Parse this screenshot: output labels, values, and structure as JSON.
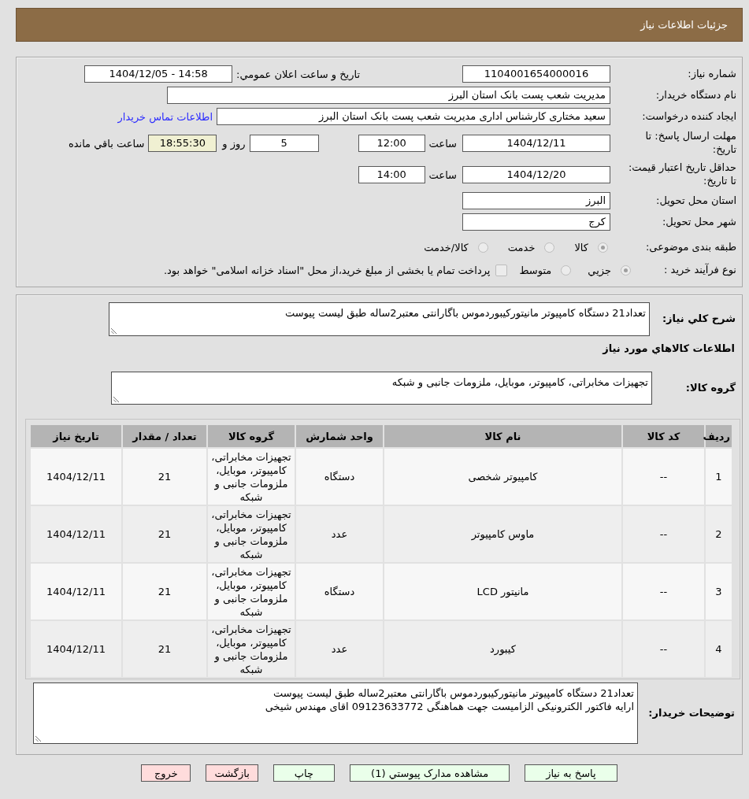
{
  "header": {
    "title": "جزئیات اطلاعات نیاز"
  },
  "details": {
    "need_number": {
      "label": "شماره نیاز:",
      "value": "1104001654000016"
    },
    "announcement": {
      "label": "تاریخ و ساعت اعلان عمومي:",
      "value": "1404/12/05 - 14:58"
    },
    "buyer_org": {
      "label": "نام دستگاه خریدار:",
      "value": "مدیریت شعب پست بانک استان البرز"
    },
    "requester": {
      "label": "ایجاد کننده درخواست:",
      "value": "سعید مختاری کارشناس اداری مدیریت شعب پست بانک استان البرز",
      "link": "اطلاعات تماس خریدار"
    },
    "response_deadline": {
      "label": "مهلت ارسال پاسخ: تا تاریخ:",
      "date": "1404/12/11",
      "time_label": "ساعت",
      "time": "12:00",
      "days": "5",
      "days_label": "روز و",
      "remaining": "18:55:30",
      "remaining_label": "ساعت باقي مانده"
    },
    "price_validity": {
      "label": "حداقل تاریخ اعتبار قیمت: تا تاریخ:",
      "date": "1404/12/20",
      "time_label": "ساعت",
      "time": "14:00"
    },
    "province": {
      "label": "استان محل تحویل:",
      "value": "البرز"
    },
    "city": {
      "label": "شهر محل تحویل:",
      "value": "کرج"
    },
    "category": {
      "label": "طبقه بندی موضوعی:",
      "disabled": true,
      "options": [
        {
          "label": "کالا",
          "selected": true
        },
        {
          "label": "خدمت",
          "selected": false
        },
        {
          "label": "کالا/خدمت",
          "selected": false
        }
      ]
    },
    "process": {
      "label": "نوع فرآیند خرید :",
      "disabled": true,
      "options": [
        {
          "label": "جزيي",
          "selected": true
        },
        {
          "label": "متوسط",
          "selected": false
        }
      ],
      "treasury": {
        "label": "پرداخت تمام یا بخشی از مبلغ خرید،از محل \"اسناد خزانه اسلامی\" خواهد بود.",
        "checked": false
      }
    }
  },
  "need": {
    "summary": {
      "label": "شرح کلي نیاز:",
      "value": "تعداد21 دستگاه کامپیوتر مانیتورکیبوردموس باگارانتی معتبر2ساله طبق لیست پیوست"
    },
    "goods_title": "اطلاعات کالاهاي مورد نیاز",
    "goods_group": {
      "label": "گروه کالا:",
      "value": "تجهیزات مخابراتی، کامپیوتر، موبایل، ملزومات جانبی و شبکه"
    },
    "table": {
      "columns": [
        "ردیف",
        "کد کالا",
        "نام کالا",
        "واحد شمارش",
        "گروه کالا",
        "تعداد / مقدار",
        "تاریخ نیاز"
      ],
      "rows": [
        [
          "1",
          "--",
          "کامپیوتر شخصی",
          "دستگاه",
          "تجهیزات مخابراتی، کامپیوتر، موبایل، ملزومات جانبی و شبکه",
          "21",
          "1404/12/11"
        ],
        [
          "2",
          "--",
          "ماوس کامپیوتر",
          "عدد",
          "تجهیزات مخابراتی، کامپیوتر، موبایل، ملزومات جانبی و شبکه",
          "21",
          "1404/12/11"
        ],
        [
          "3",
          "--",
          "مانیتور LCD",
          "دستگاه",
          "تجهیزات مخابراتی، کامپیوتر، موبایل، ملزومات جانبی و شبکه",
          "21",
          "1404/12/11"
        ],
        [
          "4",
          "--",
          "کیبورد",
          "عدد",
          "تجهیزات مخابراتی، کامپیوتر، موبایل، ملزومات جانبی و شبکه",
          "21",
          "1404/12/11"
        ]
      ]
    },
    "buyer_notes": {
      "label": "توضیحات خریدار:",
      "value": "تعداد21 دستگاه کامپیوتر مانیتورکیبوردموس باگارانتی معتبر2ساله طبق لیست پیوست\nارایه فاکتور الکترونیکی الزامیست جهت هماهنگی 09123633772 اقای مهندس شیخی"
    }
  },
  "buttons": [
    {
      "label": "پاسخ به نیاز",
      "kind": "action"
    },
    {
      "label": "مشاهده مدارک پیوستي (1)",
      "kind": "action"
    },
    {
      "label": "چاپ",
      "kind": "action"
    },
    {
      "label": "بازگشت",
      "kind": "leave"
    },
    {
      "label": "خروج",
      "kind": "leave"
    }
  ]
}
